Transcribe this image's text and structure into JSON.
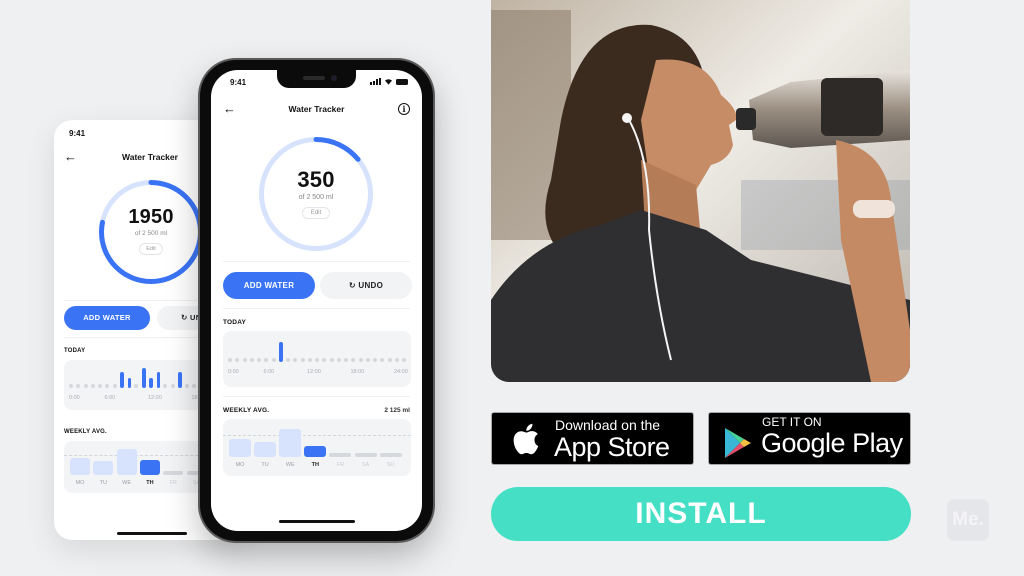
{
  "colors": {
    "background": "#eff0f2",
    "accent": "#3a74f5",
    "accent_light": "#d7e3fd",
    "install": "#44dfc4",
    "placeholder": "#d5d8dd"
  },
  "app": {
    "status_time": "9:41",
    "title": "Water Tracker",
    "back_icon": "arrow-left-icon",
    "info_icon": "info-icon",
    "goal_label": "of 2 500 ml",
    "edit_label": "Edit",
    "add_water_label": "ADD WATER",
    "undo_label": "UNDO",
    "undo_icon": "↻",
    "today_label": "TODAY",
    "weekly_label": "WEEKLY AVG.",
    "hour_ticks": [
      "0:00",
      "6:00",
      "12:00",
      "18:00",
      "24:00"
    ],
    "days": [
      "MO",
      "TU",
      "WE",
      "TH",
      "FR",
      "SA",
      "SU"
    ]
  },
  "screens": {
    "front": {
      "intake": "350",
      "intake_ml": 350,
      "goal_ml": 2500,
      "weekly_avg": "2 125 ml",
      "weekly_avg_ml": 2125,
      "today_hourly_level": [
        0,
        0,
        0,
        0,
        0,
        0,
        0,
        0.9,
        0,
        0,
        0,
        0,
        0,
        0,
        0,
        0,
        0,
        0,
        0,
        0,
        0,
        0,
        0,
        0,
        0
      ],
      "weekly_ml": [
        1750,
        1450,
        2700,
        1050,
        null,
        null,
        null
      ],
      "current_day_index": 3
    },
    "back": {
      "intake": "1950",
      "intake_ml": 1950,
      "goal_ml": 2500,
      "weekly_avg_ml": 2125,
      "today_hourly_level": [
        0,
        0,
        0,
        0,
        0,
        0,
        0,
        1.0,
        0.6,
        0,
        1.25,
        0.6,
        1.0,
        0,
        0,
        1.0,
        0,
        0,
        0,
        0,
        0,
        0,
        0,
        0,
        0
      ],
      "weekly_ml": [
        1750,
        1450,
        2700,
        1600,
        null,
        null,
        null
      ],
      "current_day_index": 3
    }
  },
  "store": {
    "apple_small": "Download on the",
    "apple_big": "App Store",
    "google_small": "GET IT ON",
    "google_big": "Google Play"
  },
  "cta": {
    "install_label": "INSTALL"
  },
  "brand": {
    "logo_text": "Me."
  }
}
